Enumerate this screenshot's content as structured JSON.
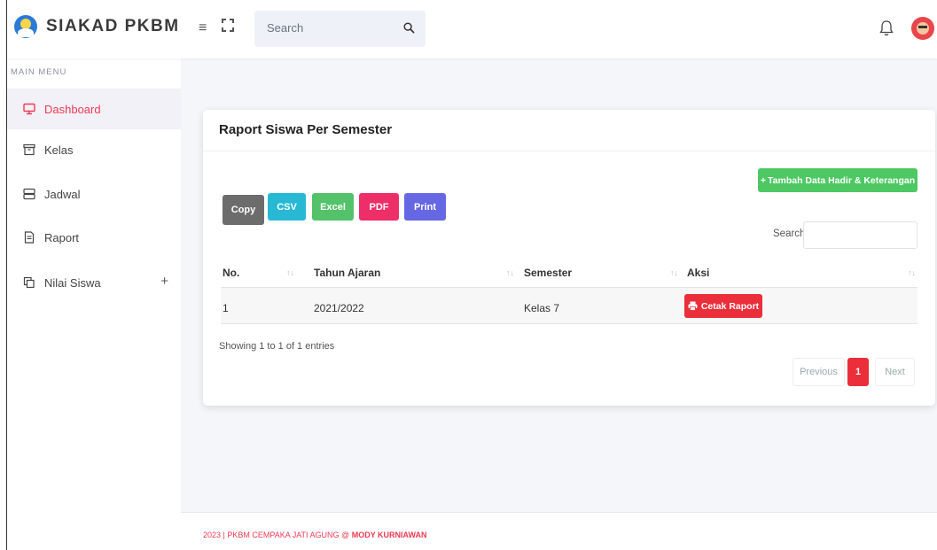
{
  "app": {
    "brand": "SIAKAD PKBM"
  },
  "topbar": {
    "search_placeholder": "Search"
  },
  "sidebar": {
    "menu_title": "MAIN MENU",
    "items": [
      {
        "label": "Dashboard",
        "icon": "monitor-icon",
        "active": true
      },
      {
        "label": "Kelas",
        "icon": "archive-icon"
      },
      {
        "label": "Jadwal",
        "icon": "server-icon"
      },
      {
        "label": "Raport",
        "icon": "document-icon"
      },
      {
        "label": "Nilai Siswa",
        "icon": "copy-icon",
        "expand": "+"
      }
    ]
  },
  "card": {
    "title": "Raport Siswa Per Semester",
    "add_button": "Tambah Data Hadir & Keterangan",
    "export_buttons": [
      "Copy",
      "CSV",
      "Excel",
      "PDF",
      "Print"
    ],
    "search_label": "Search:",
    "table": {
      "columns": [
        "No.",
        "Tahun Ajaran",
        "Semester",
        "Aksi"
      ],
      "rows": [
        {
          "no": "1",
          "tahun_ajaran": "2021/2022",
          "semester": "Kelas 7",
          "aksi": "Cetak Raport"
        }
      ]
    },
    "info": "Showing 1 to 1 of 1 entries",
    "pagination": {
      "prev": "Previous",
      "current": "1",
      "next": "Next"
    }
  },
  "footer": {
    "text": "2023 | PKBM CEMPAKA JATI AGUNG @ ",
    "author": "MODY KURNIAWAN"
  },
  "colors": {
    "accent": "#ef3a53",
    "green": "#4dc863",
    "danger": "#ea2f3b"
  }
}
